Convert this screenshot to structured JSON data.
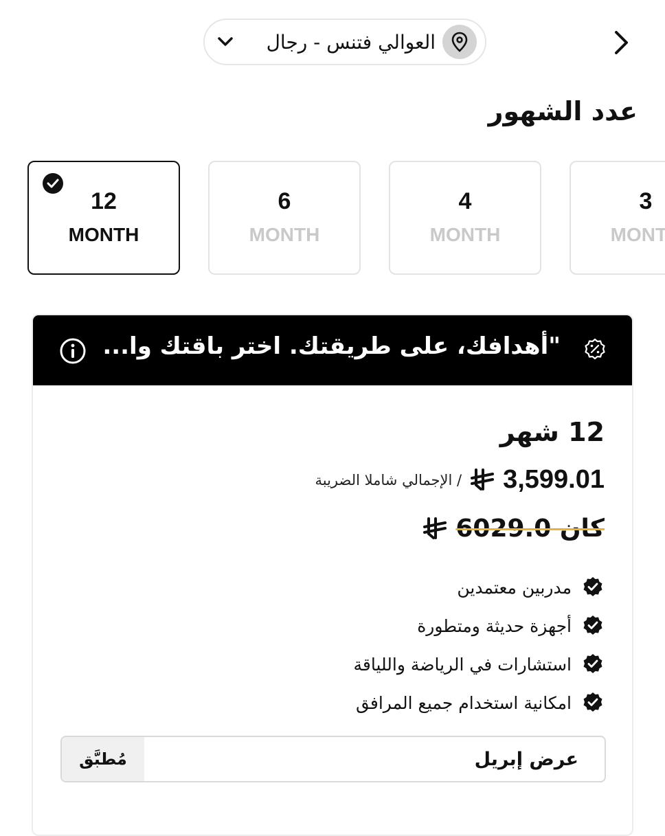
{
  "header": {
    "location": "العوالي فتنس - رجال",
    "icons": {
      "back": "chevron-right-icon",
      "pin": "location-pin-icon",
      "dropdown": "chevron-down-icon"
    }
  },
  "months_section": {
    "title": "عدد الشهور",
    "options": [
      {
        "value": "12",
        "unit": "MONTH",
        "selected": true
      },
      {
        "value": "6",
        "unit": "MONTH",
        "selected": false
      },
      {
        "value": "4",
        "unit": "MONTH",
        "selected": false
      },
      {
        "value": "3",
        "unit": "MONTH",
        "selected": false
      }
    ]
  },
  "plan": {
    "banner_text": "\"أهدافك، على طريقتك. اختر باقتك وا...",
    "title": "12 شهر",
    "price": "3,599.01",
    "currency_icon": "riyal-icon",
    "price_note": "/ الإجمالي شاملا الضريبة",
    "old_price_label": "كان 6029.0",
    "features": [
      "مدربين معتمدين",
      "أجهزة حديثة ومتطورة",
      "استشارات في الرياضة واللياقة",
      "امكانية استخدام جميع المرافق"
    ],
    "offer": {
      "name": "عرض إبريل",
      "status": "مُطبَّق"
    }
  },
  "colors": {
    "accent_strike": "#e7b332",
    "banner_bg": "#000000",
    "muted_text": "#c9c9c9"
  }
}
